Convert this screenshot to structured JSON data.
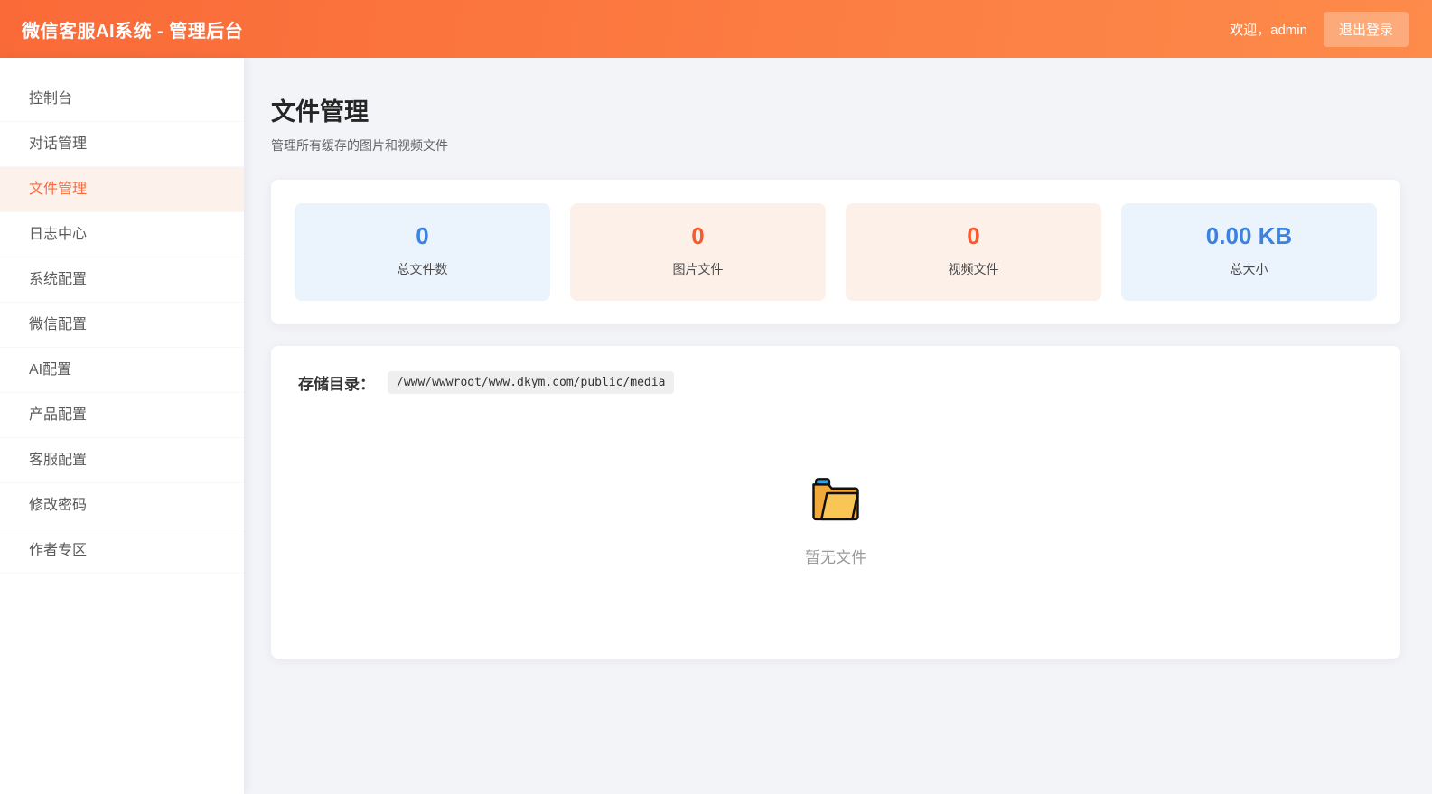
{
  "header": {
    "title": "微信客服AI系统 - 管理后台",
    "welcome": "欢迎，admin",
    "logout_label": "退出登录"
  },
  "sidebar": {
    "items": [
      {
        "label": "控制台",
        "active": false
      },
      {
        "label": "对话管理",
        "active": false
      },
      {
        "label": "文件管理",
        "active": true
      },
      {
        "label": "日志中心",
        "active": false
      },
      {
        "label": "系统配置",
        "active": false
      },
      {
        "label": "微信配置",
        "active": false
      },
      {
        "label": "AI配置",
        "active": false
      },
      {
        "label": "产品配置",
        "active": false
      },
      {
        "label": "客服配置",
        "active": false
      },
      {
        "label": "修改密码",
        "active": false
      },
      {
        "label": "作者专区",
        "active": false
      }
    ]
  },
  "main": {
    "page_title": "文件管理",
    "page_subtitle": "管理所有缓存的图片和视频文件",
    "stats": [
      {
        "value": "0",
        "label": "总文件数",
        "theme": "blue"
      },
      {
        "value": "0",
        "label": "图片文件",
        "theme": "orange"
      },
      {
        "value": "0",
        "label": "视频文件",
        "theme": "orange"
      },
      {
        "value": "0.00 KB",
        "label": "总大小",
        "theme": "blue"
      }
    ],
    "storage": {
      "label": "存储目录：",
      "path": "/www/wwwroot/www.dkym.com/public/media"
    },
    "empty": {
      "icon": "open-folder-icon",
      "text": "暂无文件"
    }
  },
  "colors": {
    "header_gradient_start": "#fa6a38",
    "header_gradient_end": "#fd8b4a",
    "accent_blue": "#3d82de",
    "accent_orange": "#f75a2c",
    "stat_blue_bg": "#ebf3fd",
    "stat_orange_bg": "#fdf0e9",
    "active_item_bg": "#fdf1eb",
    "active_item_color": "#f76c3f",
    "folder_body": "#f0a93a",
    "folder_flap": "#f9c557",
    "folder_tab": "#3aa0dc"
  }
}
